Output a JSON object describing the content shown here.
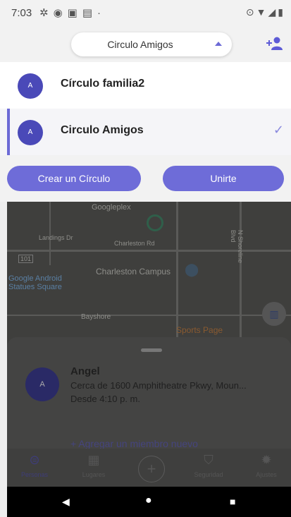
{
  "status_bar": {
    "time": "7:03",
    "left_icons": [
      "settings-icon",
      "shield-icon",
      "calendar-icon",
      "image-icon",
      "dot-icon"
    ],
    "right_icons": [
      "location-icon",
      "wifi-icon",
      "signal-icon",
      "battery-icon"
    ]
  },
  "header": {
    "selected_circle": "Circulo Amigos",
    "add_person_icon": "add-person-icon"
  },
  "circles": [
    {
      "avatar": "A",
      "name": "Círculo familia2",
      "selected": false
    },
    {
      "avatar": "A",
      "name": "Circulo Amigos",
      "selected": true
    }
  ],
  "actions": {
    "create": "Crear un Círculo",
    "join": "Unirte"
  },
  "map": {
    "labels": [
      "Googleplex",
      "Landings Dr",
      "Charleston Rd",
      "Charleston Campus",
      "Google Android Statues Square",
      "N Shoreline Blvd",
      "Sports Page",
      "Bayshore",
      "101"
    ]
  },
  "member": {
    "avatar": "A",
    "name": "Angel",
    "location": "Cerca de 1600 Amphitheatre Pkwy, Moun...",
    "since": "Desde 4:10 p. m."
  },
  "add_member": "+ Agregar un miembro nuevo",
  "bottom_nav": [
    {
      "label": "Personas",
      "icon": "people-icon"
    },
    {
      "label": "Lugares",
      "icon": "buildings-icon"
    },
    {
      "label": "",
      "icon": "plus-icon"
    },
    {
      "label": "Seguridad",
      "icon": "shield-icon"
    },
    {
      "label": "Ajustes",
      "icon": "gear-icon"
    }
  ],
  "colors": {
    "accent": "#6e6cd8",
    "avatar": "#4a49b8",
    "check": "#8a89de"
  }
}
